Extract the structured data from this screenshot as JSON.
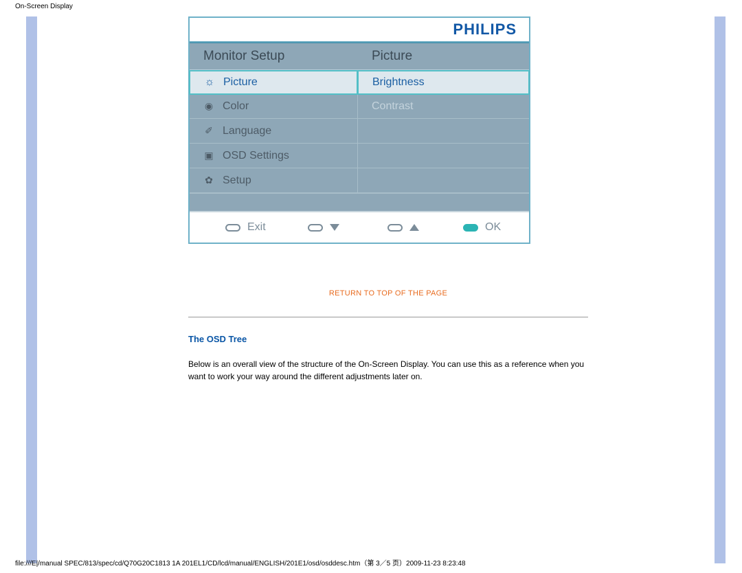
{
  "page": {
    "header_title": "On-Screen Display",
    "footer_path": "file:///E|/manual SPEC/813/spec/cd/Q70G20C1813 1A 201EL1/CD/lcd/manual/ENGLISH/201E1/osd/osddesc.htm（第 3／5 页）2009-11-23 8:23:48"
  },
  "osd": {
    "brand": "PHILIPS",
    "title_left": "Monitor Setup",
    "title_right": "Picture",
    "menu": [
      {
        "label": "Picture",
        "icon": "brightness-icon",
        "highlight": true
      },
      {
        "label": "Color",
        "icon": "color-icon",
        "highlight": false
      },
      {
        "label": "Language",
        "icon": "language-icon",
        "highlight": false
      },
      {
        "label": "OSD Settings",
        "icon": "osd-icon",
        "highlight": false
      },
      {
        "label": "Setup",
        "icon": "setup-icon",
        "highlight": false
      }
    ],
    "submenu": [
      {
        "label": "Brightness",
        "highlight": true
      },
      {
        "label": "Contrast",
        "highlight": false
      },
      {
        "label": "",
        "highlight": false
      },
      {
        "label": "",
        "highlight": false
      },
      {
        "label": "",
        "highlight": false
      }
    ],
    "footer": {
      "exit": "Exit",
      "ok": "OK"
    }
  },
  "content": {
    "return_link": "RETURN TO TOP OF THE PAGE",
    "section_heading": "The OSD Tree",
    "paragraph": "Below is an overall view of the structure of the On-Screen Display. You can use this as a reference when you want to work your way around the different adjustments later on."
  }
}
